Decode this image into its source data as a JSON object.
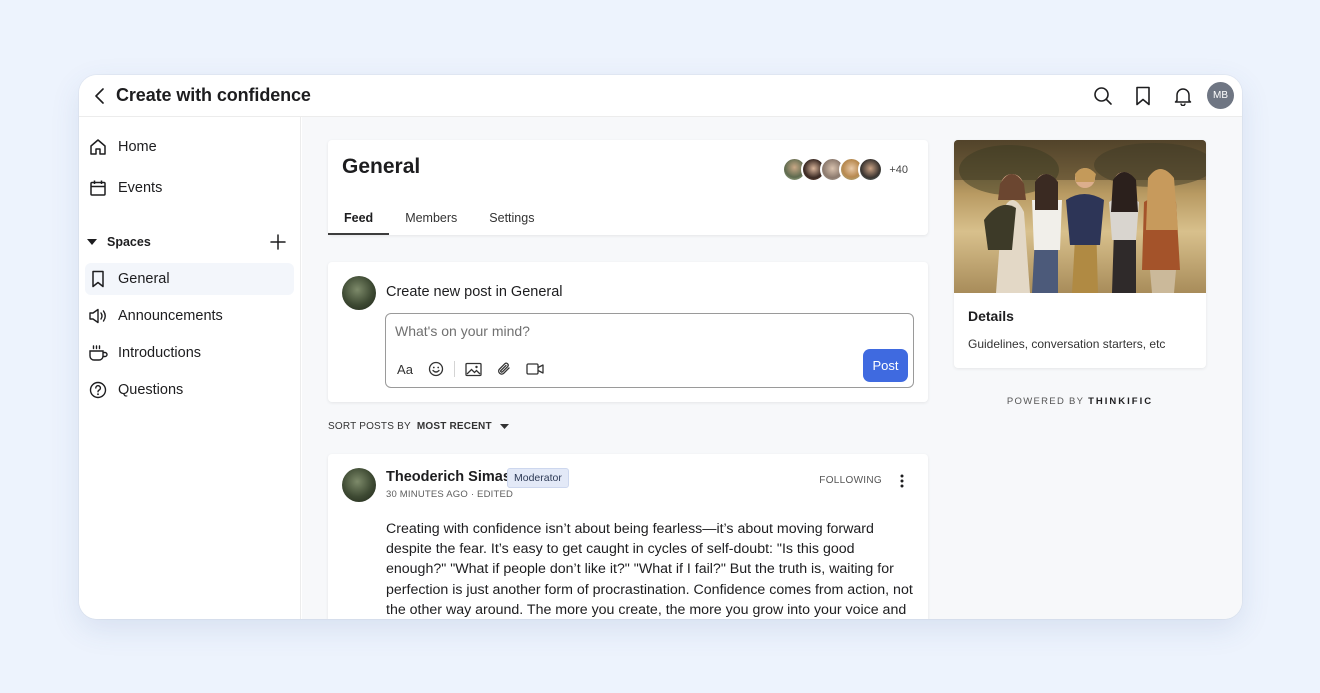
{
  "app": {
    "title": "Create with confidence",
    "user_initials": "MB"
  },
  "topbar": {
    "icons": [
      "search-icon",
      "bookmark-icon",
      "bell-icon"
    ]
  },
  "sidebar": {
    "items": [
      {
        "label": "Home",
        "icon": "home-icon"
      },
      {
        "label": "Events",
        "icon": "calendar-icon"
      }
    ],
    "spaces_label": "Spaces",
    "spaces": [
      {
        "label": "General",
        "icon": "bookmark-icon",
        "active": true
      },
      {
        "label": "Announcements",
        "icon": "megaphone-icon"
      },
      {
        "label": "Introductions",
        "icon": "coffee-cup-icon"
      },
      {
        "label": "Questions",
        "icon": "question-circle-icon"
      }
    ]
  },
  "space": {
    "title": "General",
    "member_extra": "+40",
    "tabs": [
      {
        "label": "Feed",
        "active": true
      },
      {
        "label": "Members"
      },
      {
        "label": "Settings"
      }
    ]
  },
  "composer": {
    "label": "Create new post in General",
    "placeholder": "What's on your mind?",
    "post_label": "Post",
    "tools": [
      "text-format-icon",
      "emoji-icon",
      "image-icon",
      "attachment-icon",
      "video-icon"
    ],
    "text_tool_glyph": "Aa"
  },
  "sort": {
    "label": "SORT POSTS BY",
    "value": "MOST RECENT"
  },
  "post": {
    "author": "Theoderich Simas",
    "badge": "Moderator",
    "meta": "30 MINUTES AGO · EDITED",
    "follow_label": "FOLLOWING",
    "body": "Creating with confidence isn’t about being fearless—it’s about moving forward despite the fear. It’s easy to get caught in cycles of self-doubt: \"Is this good enough?\" \"What if people don’t like it?\" \"What if I fail?\" But the truth is, waiting for perfection is just another form of procrastination. Confidence comes from action, not the other way around. The more you create, the more you grow into your voice and your"
  },
  "details": {
    "title": "Details",
    "description": "Guidelines, conversation starters, etc"
  },
  "powered": {
    "prefix": "POWERED BY",
    "brand": "THINKIFIC"
  },
  "colors": {
    "accent": "#3f6ae0",
    "background": "#edf3fd",
    "badge_bg": "#e3e9f7"
  }
}
